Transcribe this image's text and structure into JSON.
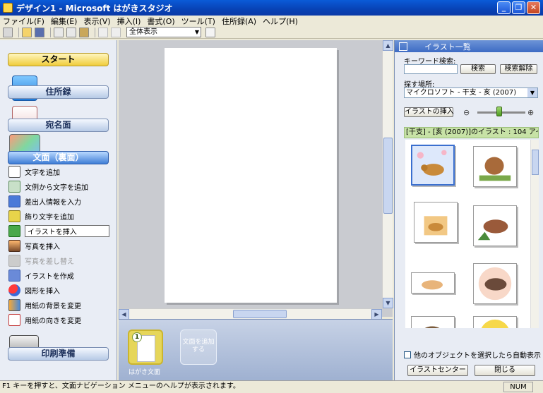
{
  "window": {
    "title": "デザイン1 - Microsoft はがきスタジオ",
    "minimize": "_",
    "restore": "❐",
    "close": "✕"
  },
  "menu": [
    "ファイル(F)",
    "編集(E)",
    "表示(V)",
    "挿入(I)",
    "書式(O)",
    "ツール(T)",
    "住所録(A)",
    "ヘルプ(H)"
  ],
  "toolbar": {
    "zoom_value": "全体表示"
  },
  "leftnav": {
    "start": "スタート",
    "address_book": "住所録",
    "recipient": "宛名面",
    "body": "文面（裏面）",
    "print_prep": "印刷準備",
    "tasks": [
      "文字を追加",
      "文例から文字を追加",
      "差出人情報を入力",
      "飾り文字を追加",
      "イラストを挿入",
      "写真を挿入",
      "写真を差し替え",
      "イラストを作成",
      "図形を挿入",
      "用紙の背景を変更",
      "用紙の向きを変更"
    ]
  },
  "pagestrip": {
    "page_number": "1",
    "page_label": "はがき文面",
    "add_label": "文面を追加する"
  },
  "illust_panel": {
    "title": "イラスト一覧",
    "keyword_label": "キーワード検索:",
    "search_btn": "検索",
    "clear_btn": "検索解除",
    "place_label": "探す場所:",
    "place_value": "マイクロソフト - 干支 - 亥 (2007)",
    "insert_btn": "イラストの挿入",
    "zoom_minus": "⊖",
    "zoom_plus": "⊕",
    "zoom_level": 0.45,
    "gallery_header": "[干支] - [亥 (2007)]のイラスト : 104 アイテム",
    "auto_show_label": "他のオブジェクトを選択したら自動表示",
    "center_btn": "イラストセンター",
    "close_btn": "閉じる"
  },
  "status": {
    "message": "F1 キーを押すと、文面ナビゲーション メニューのヘルプが表示されます。",
    "num": "NUM"
  },
  "colors": {
    "titlebar": "#0842b5",
    "nav_active": "#3f7ed6",
    "start_gold": "#f0cc3a",
    "gallery_header": "#c7e2a6"
  }
}
